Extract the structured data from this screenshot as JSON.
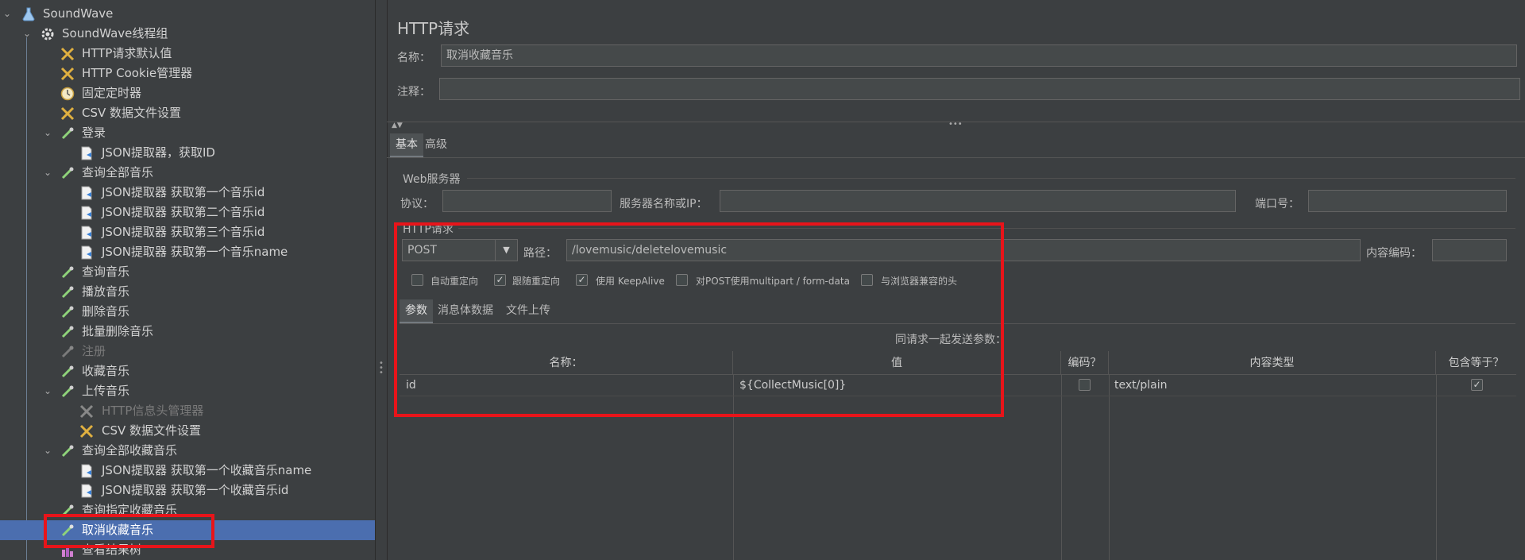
{
  "tree": {
    "items": [
      {
        "label": "SoundWave",
        "icon": "flask-icon"
      },
      {
        "label": "SoundWave线程组",
        "icon": "gear-icon"
      },
      {
        "label": "HTTP请求默认值",
        "icon": "tools-icon"
      },
      {
        "label": "HTTP Cookie管理器",
        "icon": "tools-icon"
      },
      {
        "label": "固定定时器",
        "icon": "clock-icon"
      },
      {
        "label": "CSV 数据文件设置",
        "icon": "tools-icon"
      },
      {
        "label": "登录",
        "icon": "pipette-icon"
      },
      {
        "label": "JSON提取器，获取ID",
        "icon": "document-icon"
      },
      {
        "label": "查询全部音乐",
        "icon": "pipette-icon"
      },
      {
        "label": "JSON提取器 获取第一个音乐id",
        "icon": "document-icon"
      },
      {
        "label": "JSON提取器 获取第二个音乐id",
        "icon": "document-icon"
      },
      {
        "label": "JSON提取器 获取第三个音乐id",
        "icon": "document-icon"
      },
      {
        "label": "JSON提取器 获取第一个音乐name",
        "icon": "document-icon"
      },
      {
        "label": "查询音乐",
        "icon": "pipette-icon"
      },
      {
        "label": "播放音乐",
        "icon": "pipette-icon"
      },
      {
        "label": "删除音乐",
        "icon": "pipette-icon"
      },
      {
        "label": "批量删除音乐",
        "icon": "pipette-icon"
      },
      {
        "label": "注册",
        "icon": "pipette-icon",
        "disabled": true
      },
      {
        "label": "收藏音乐",
        "icon": "pipette-icon"
      },
      {
        "label": "上传音乐",
        "icon": "pipette-icon"
      },
      {
        "label": "HTTP信息头管理器",
        "icon": "tools-icon",
        "disabled": true
      },
      {
        "label": "CSV 数据文件设置",
        "icon": "tools-icon"
      },
      {
        "label": "查询全部收藏音乐",
        "icon": "pipette-icon"
      },
      {
        "label": "JSON提取器 获取第一个收藏音乐name",
        "icon": "document-icon"
      },
      {
        "label": "JSON提取器 获取第一个收藏音乐id",
        "icon": "document-icon"
      },
      {
        "label": "查询指定收藏音乐",
        "icon": "pipette-icon"
      },
      {
        "label": "取消收藏音乐",
        "icon": "pipette-icon",
        "selected": true
      },
      {
        "label": "查看结果树",
        "icon": "chart-icon"
      }
    ]
  },
  "panel": {
    "title": "HTTP请求",
    "name_label": "名称：",
    "name_value": "取消收藏音乐",
    "comment_label": "注释：",
    "comment_value": "",
    "tabs": [
      "基本",
      "高级"
    ]
  },
  "web_server": {
    "section_title": "Web服务器",
    "protocol_label": "协议：",
    "protocol_value": "",
    "server_label": "服务器名称或IP：",
    "server_value": "",
    "port_label": "端口号：",
    "port_value": ""
  },
  "http_request": {
    "section_title": "HTTP请求",
    "method": "POST",
    "path_label": "路径：",
    "path_value": "/lovemusic/deletelovemusic",
    "encoding_label": "内容编码：",
    "encoding_value": "",
    "checkboxes": [
      {
        "label": "自动重定向",
        "checked": false
      },
      {
        "label": "跟随重定向",
        "checked": true
      },
      {
        "label": "使用 KeepAlive",
        "checked": true
      },
      {
        "label": "对POST使用multipart / form-data",
        "checked": false
      },
      {
        "label": "与浏览器兼容的头",
        "checked": false
      }
    ],
    "subtabs": [
      "参数",
      "消息体数据",
      "文件上传"
    ],
    "params_caption": "同请求一起发送参数："
  },
  "params_table": {
    "headers": [
      "名称：",
      "值",
      "编码？",
      "内容类型",
      "包含等于？"
    ],
    "rows": [
      {
        "name": "id",
        "value": "${CollectMusic[0]}",
        "encode": false,
        "content_type": "text/plain",
        "include_equals": true
      }
    ]
  },
  "annotation_color": "#e8141a",
  "selection_color": "#4b6eaf"
}
